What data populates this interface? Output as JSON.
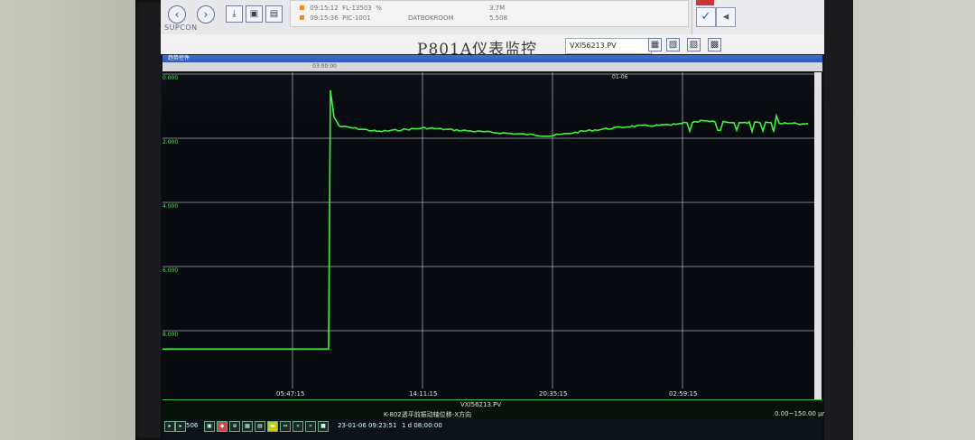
{
  "toolbar": {
    "brand": "SUPCON",
    "alarm_rows": [
      {
        "time": "09:15:12",
        "tag": "FL-13503",
        "unit": "%",
        "text": "",
        "value": "3.7M"
      },
      {
        "time": "09:15:36",
        "tag": "PIC-1001",
        "unit": "",
        "text": "DATBOKROOM",
        "value": "5.508"
      }
    ]
  },
  "header": {
    "page_title": "P801A仪表监控",
    "tag_name": "VXI56213.PV",
    "window_label": "趋势控件",
    "sub_label": "03:00:00"
  },
  "plot": {
    "y_ticks": [
      "0.000",
      "2.000",
      "4.000",
      "6.000",
      "8.000"
    ],
    "x_ticks": [
      "05:47:15",
      "14:11:15",
      "20:35:15",
      "02:59:15"
    ],
    "top_marker": "01-06",
    "line_color": "#3ff23a",
    "grid_color": "#cfd4d8"
  },
  "status": {
    "series_tag": "VXI56213.PV",
    "series_desc": "K-802透平前振动轴位移-X方向",
    "date_time": "23-01-06 09:23:51",
    "range": "1 d 08:00:00",
    "readout": "0.00~150.00 μm",
    "count": "506"
  },
  "chart_data": {
    "type": "line",
    "x": [
      "05:47:15",
      "09:00",
      "10:00",
      "10:30",
      "11:00",
      "12:00",
      "14:11:15",
      "16:00",
      "18:00",
      "20:35:15",
      "22:00",
      "00:00",
      "02:59:15",
      "04:00",
      "05:30"
    ],
    "values": [
      7.65,
      7.65,
      7.65,
      0.4,
      1.4,
      1.55,
      1.5,
      1.6,
      1.7,
      1.75,
      1.55,
      1.5,
      1.3,
      1.4,
      1.35
    ],
    "ylim": [
      0,
      8.8
    ]
  }
}
